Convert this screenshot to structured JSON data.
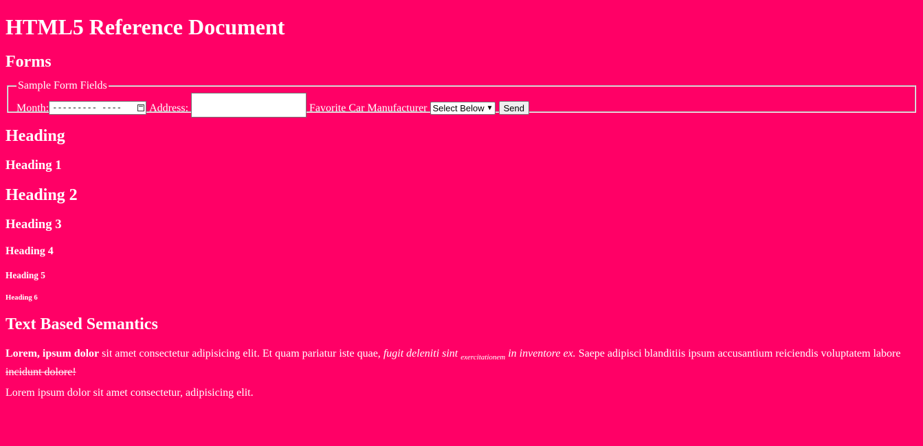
{
  "page": {
    "title": "HTML5 Reference Document"
  },
  "forms": {
    "heading": "Forms",
    "legend": "Sample Form Fields",
    "month_label": "Month:",
    "month_value": "---------   ----",
    "address_label": "Address:",
    "address_value": "",
    "car_label": "Favorite Car Manufacturer",
    "car_select_value": "Select Below",
    "send_label": "Send"
  },
  "headings": {
    "section": "Heading",
    "h1": "Heading 1",
    "h2": "Heading 2",
    "h3": "Heading 3",
    "h4": "Heading 4",
    "h5": "Heading 5",
    "h6": "Heading 6"
  },
  "semantics": {
    "heading": "Text Based Semantics",
    "bold": "Lorem, ipsum dolor",
    "text1": " sit amet consectetur adipisicing elit. Et quam pariatur iste quae, ",
    "italic1": "fugit deleniti sint ",
    "sub": "exercitationem",
    "italic2": " in inventore ex.",
    "text2": " Saepe adipisci blanditiis ipsum accusantium reiciendis voluptatem labore ",
    "strike": "incidunt dolore!",
    "para2": "Lorem ipsum dolor sit amet consectetur, adipisicing elit."
  },
  "colors": {
    "background": "#ff0066",
    "text": "#ffffff"
  }
}
